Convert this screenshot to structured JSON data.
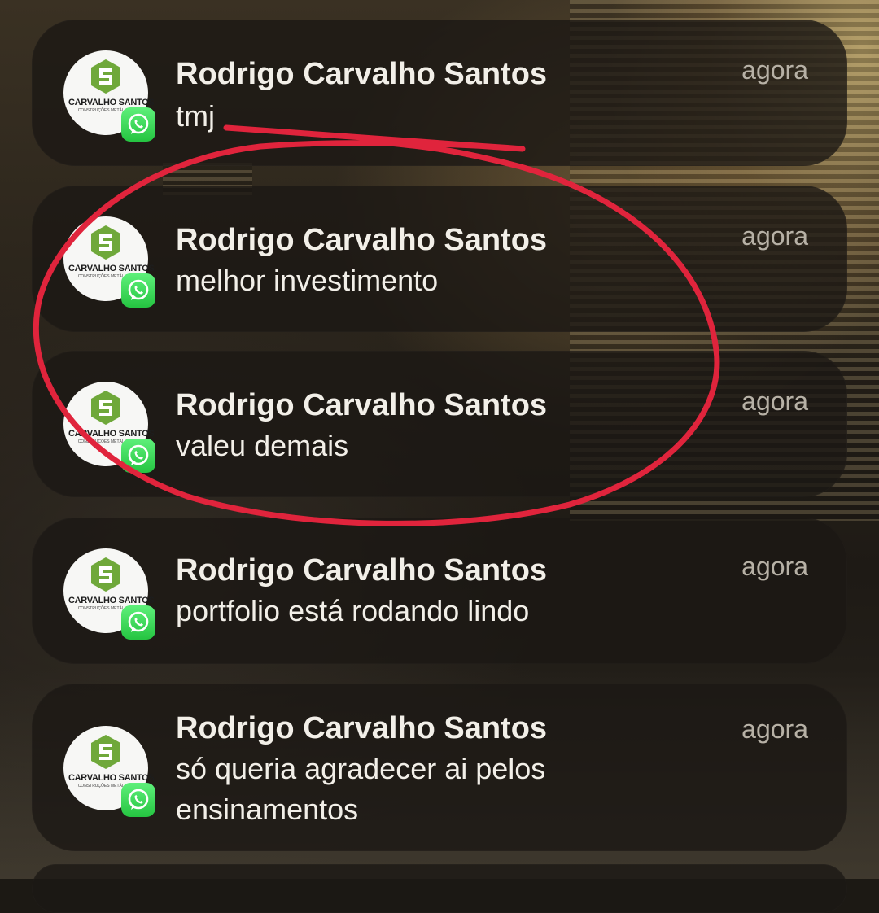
{
  "theme": {
    "annotation_color": "#e0243c",
    "whatsapp_green": "#25c441"
  },
  "avatar": {
    "brand": "CARVALHO SANTOS",
    "tagline": "CONSTRUÇÕES METÁLICAS",
    "badge_icon": "whatsapp-icon"
  },
  "notifications": [
    {
      "sender": "Rodrigo Carvalho Santos",
      "message": "tmj",
      "time": "agora"
    },
    {
      "sender": "Rodrigo Carvalho Santos",
      "message": "melhor investimento",
      "time": "agora"
    },
    {
      "sender": "Rodrigo Carvalho Santos",
      "message": "valeu demais",
      "time": "agora"
    },
    {
      "sender": "Rodrigo Carvalho Santos",
      "message": "portfolio está rodando lindo",
      "time": "agora"
    },
    {
      "sender": "Rodrigo Carvalho Santos",
      "message": "só queria agradecer ai pelos",
      "message_line2": "ensinamentos",
      "time": "agora"
    }
  ]
}
